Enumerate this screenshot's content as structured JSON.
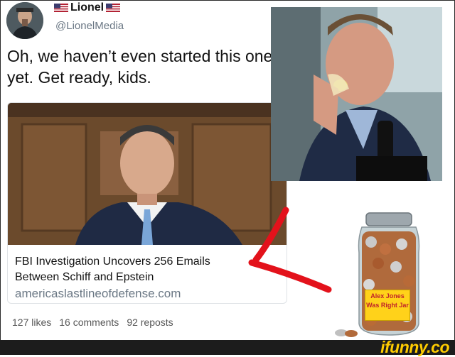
{
  "tweet": {
    "display_name": "Lionel",
    "handle": "@LionelMedia",
    "text": "Oh, we haven’t even started this one yet. Get ready, kids.",
    "link_card": {
      "headline": "FBI Investigation Uncovers 256 Emails Between Schiff and Epstein",
      "domain": "americaslastlineofdefense.com"
    },
    "engagement": {
      "likes": "127 likes",
      "comments": "16 comments",
      "reposts": "92 reposts"
    }
  },
  "jar_label": "Alex Jones Was Right Jar",
  "watermark": "ifunny.co",
  "colors": {
    "arrow": "#e3121b",
    "jar_label_bg": "#ffd21a",
    "watermark": "#ffcc00"
  },
  "icons": [
    "us-flag-icon",
    "red-arrow-icon"
  ]
}
